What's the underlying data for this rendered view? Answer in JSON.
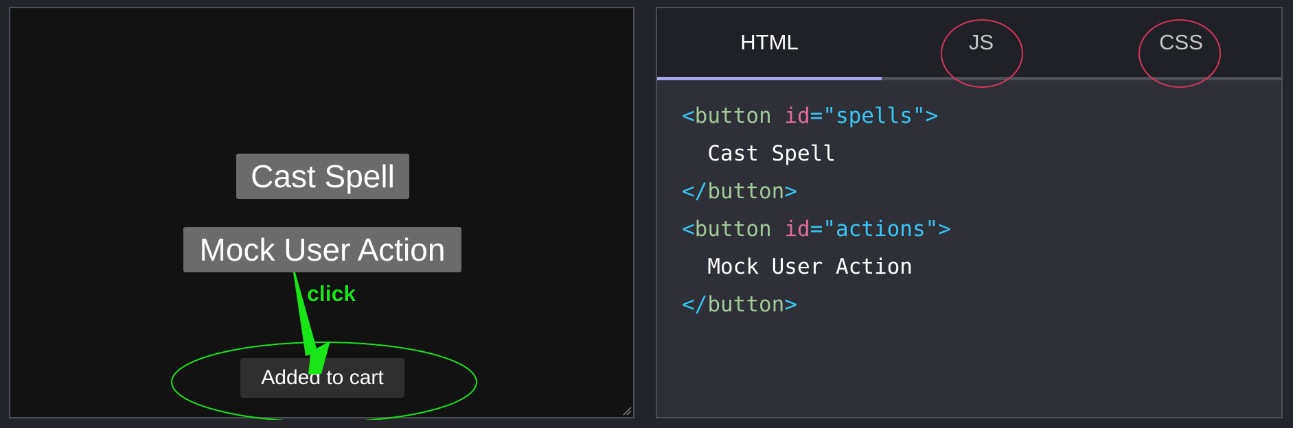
{
  "preview": {
    "cast_spell_button": "Cast Spell",
    "mock_action_button": "Mock User Action",
    "toast_text": "Added to cart",
    "annotation": {
      "label": "click",
      "color": "#19e619"
    }
  },
  "editor": {
    "tabs": [
      "HTML",
      "JS",
      "CSS"
    ],
    "active_tab": "HTML",
    "highlighted_tabs_color": "#d9335a",
    "code": {
      "lt": "<",
      "lt_close": "</",
      "gt": ">",
      "eq_quote": "=\"",
      "quote_gt": "\">",
      "tag": "button",
      "attr": "id",
      "id1": "spells",
      "text1": "  Cast Spell",
      "id2": "actions",
      "text2": "  Mock User Action"
    }
  }
}
